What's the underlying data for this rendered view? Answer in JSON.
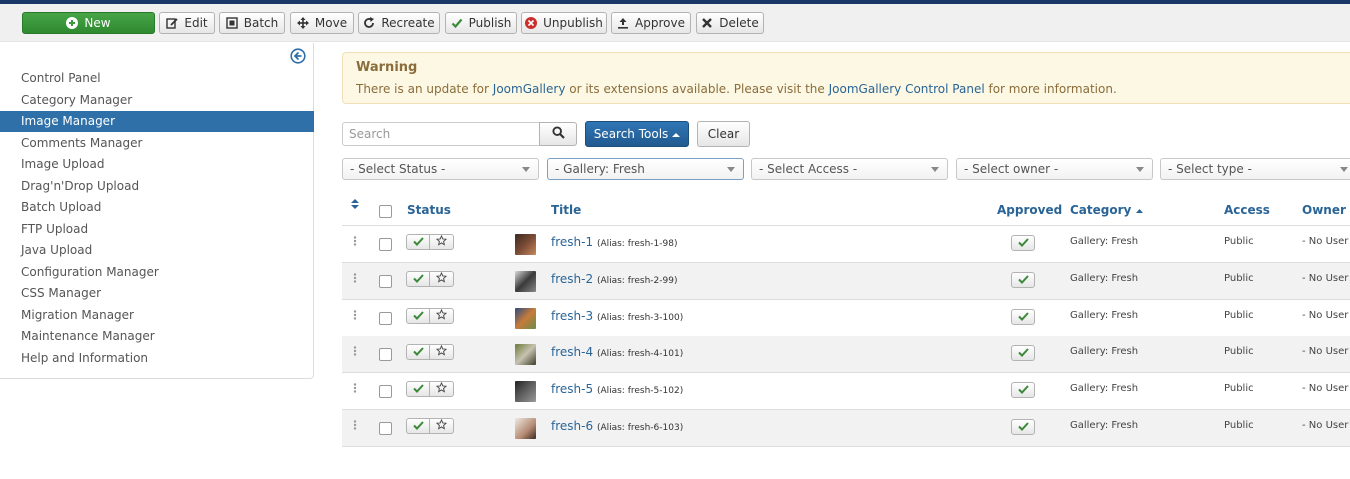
{
  "toolbar": {
    "new": "New",
    "edit": "Edit",
    "batch": "Batch",
    "move": "Move",
    "recreate": "Recreate",
    "publish": "Publish",
    "unpublish": "Unpublish",
    "approve": "Approve",
    "delete": "Delete"
  },
  "sidebar": {
    "items": [
      {
        "label": "Control Panel"
      },
      {
        "label": "Category Manager"
      },
      {
        "label": "Image Manager",
        "active": true
      },
      {
        "label": "Comments Manager"
      },
      {
        "label": "Image Upload"
      },
      {
        "label": "Drag'n'Drop Upload"
      },
      {
        "label": "Batch Upload"
      },
      {
        "label": "FTP Upload"
      },
      {
        "label": "Java Upload"
      },
      {
        "label": "Configuration Manager"
      },
      {
        "label": "CSS Manager"
      },
      {
        "label": "Migration Manager"
      },
      {
        "label": "Maintenance Manager"
      },
      {
        "label": "Help and Information"
      }
    ]
  },
  "warning": {
    "heading": "Warning",
    "text_before": "There is an update for ",
    "link1": "JoomGallery",
    "text_middle": " or its extensions available. Please visit the ",
    "link2": "JoomGallery Control Panel",
    "text_after": " for more information."
  },
  "search": {
    "placeholder": "Search",
    "tools_label": "Search Tools",
    "clear_label": "Clear"
  },
  "filters": {
    "status": "- Select Status -",
    "gallery": "- Gallery: Fresh",
    "access": "- Select Access -",
    "owner": "- Select owner -",
    "type": "- Select type -"
  },
  "table": {
    "headers": {
      "status": "Status",
      "title": "Title",
      "approved": "Approved",
      "category": "Category",
      "access": "Access",
      "owner": "Owner"
    },
    "rows": [
      {
        "title": "fresh-1",
        "alias": "(Alias: fresh-1-98)",
        "category": "Gallery: Fresh",
        "access": "Public",
        "owner": "- No User -"
      },
      {
        "title": "fresh-2",
        "alias": "(Alias: fresh-2-99)",
        "category": "Gallery: Fresh",
        "access": "Public",
        "owner": "- No User -"
      },
      {
        "title": "fresh-3",
        "alias": "(Alias: fresh-3-100)",
        "category": "Gallery: Fresh",
        "access": "Public",
        "owner": "- No User -"
      },
      {
        "title": "fresh-4",
        "alias": "(Alias: fresh-4-101)",
        "category": "Gallery: Fresh",
        "access": "Public",
        "owner": "- No User -"
      },
      {
        "title": "fresh-5",
        "alias": "(Alias: fresh-5-102)",
        "category": "Gallery: Fresh",
        "access": "Public",
        "owner": "- No User -"
      },
      {
        "title": "fresh-6",
        "alias": "(Alias: fresh-6-103)",
        "category": "Gallery: Fresh",
        "access": "Public",
        "owner": "- No User -"
      }
    ]
  },
  "colors": {
    "accent": "#2f70a8",
    "link": "#2a6496",
    "new_button": "#3c9a3c",
    "warning_bg": "#fcf8e3",
    "warning_text": "#8a6d3b",
    "check_green": "#3a8a3a"
  }
}
